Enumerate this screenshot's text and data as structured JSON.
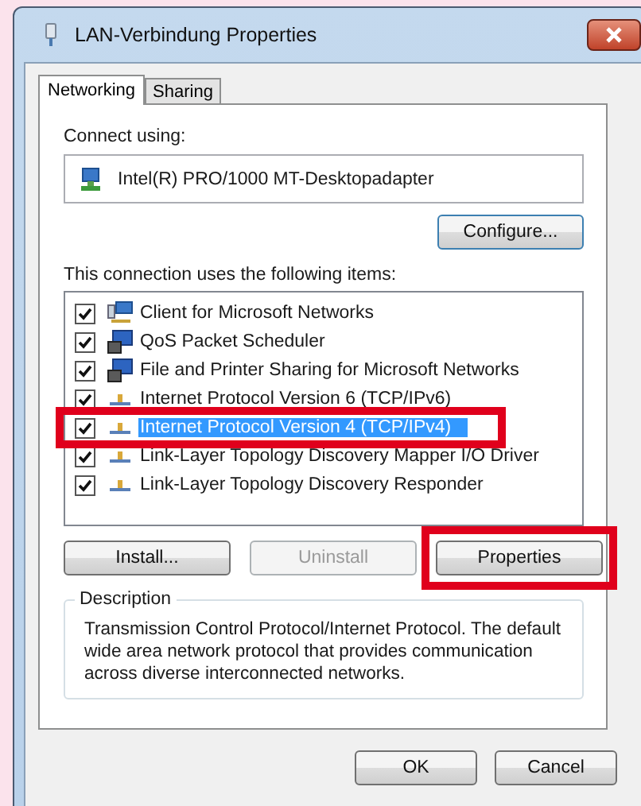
{
  "window": {
    "title": "LAN-Verbindung Properties"
  },
  "tabs": [
    {
      "label": "Networking",
      "selected": true
    },
    {
      "label": "Sharing",
      "selected": false
    }
  ],
  "connect_using": {
    "label": "Connect using:",
    "adapter": "Intel(R) PRO/1000 MT-Desktopadapter",
    "button": "Configure..."
  },
  "items_label": "This connection uses the following items:",
  "items": [
    {
      "kind": "client",
      "label": "Client for Microsoft Networks",
      "checked": true,
      "selected": false,
      "highlighted": false
    },
    {
      "kind": "service",
      "label": "QoS Packet Scheduler",
      "checked": true,
      "selected": false,
      "highlighted": false
    },
    {
      "kind": "service",
      "label": "File and Printer Sharing for Microsoft Networks",
      "checked": true,
      "selected": false,
      "highlighted": false
    },
    {
      "kind": "protocol",
      "label": "Internet Protocol Version 6 (TCP/IPv6)",
      "checked": true,
      "selected": false,
      "highlighted": false
    },
    {
      "kind": "protocol",
      "label": "Internet Protocol Version 4 (TCP/IPv4)",
      "checked": true,
      "selected": true,
      "highlighted": true
    },
    {
      "kind": "protocol",
      "label": "Link-Layer Topology Discovery Mapper I/O Driver",
      "checked": true,
      "selected": false,
      "highlighted": false
    },
    {
      "kind": "protocol",
      "label": "Link-Layer Topology Discovery Responder",
      "checked": true,
      "selected": false,
      "highlighted": false
    }
  ],
  "item_buttons": [
    {
      "label": "Install...",
      "disabled": false,
      "highlighted": false
    },
    {
      "label": "Uninstall",
      "disabled": true,
      "highlighted": false
    },
    {
      "label": "Properties",
      "disabled": false,
      "highlighted": true
    }
  ],
  "description": {
    "legend": "Description",
    "text": "Transmission Control Protocol/Internet Protocol. The default wide area network protocol that provides communication across diverse interconnected networks."
  },
  "dialog_buttons": [
    "OK",
    "Cancel"
  ]
}
